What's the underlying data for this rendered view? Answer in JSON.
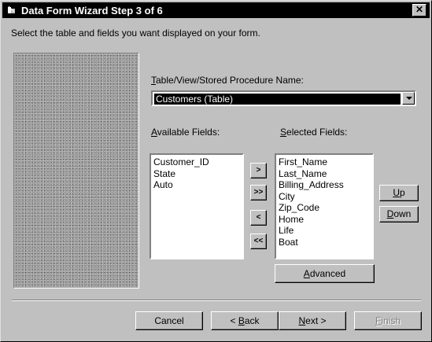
{
  "window": {
    "title": "Data Form Wizard Step 3 of 6",
    "close_label": "✕"
  },
  "instructions": "Select the table and fields you want displayed on your form.",
  "source": {
    "label_first": "T",
    "label_rest": "able/View/Stored Procedure Name:",
    "selected": "Customers (Table)"
  },
  "available": {
    "label_first": "A",
    "label_rest": "vailable Fields:",
    "items": [
      "Customer_ID",
      "State",
      "Auto"
    ]
  },
  "selected_fields": {
    "label_first": "S",
    "label_rest": "elected Fields:",
    "items": [
      "First_Name",
      "Last_Name",
      "Billing_Address",
      "City",
      "Zip_Code",
      "Home",
      "Life",
      "Boat"
    ]
  },
  "transfer": {
    "add_one": ">",
    "add_all": ">>",
    "remove_one": "<",
    "remove_all": "<<"
  },
  "order": {
    "up_first": "U",
    "up_rest": "p",
    "down_first": "D",
    "down_rest": "own"
  },
  "advanced": {
    "first": "A",
    "rest": "dvanced"
  },
  "footer": {
    "cancel": "Cancel",
    "back_pre": "< ",
    "back_first": "B",
    "back_rest": "ack",
    "next_first": "N",
    "next_rest": "ext >",
    "finish_first": "F",
    "finish_rest": "inish"
  }
}
